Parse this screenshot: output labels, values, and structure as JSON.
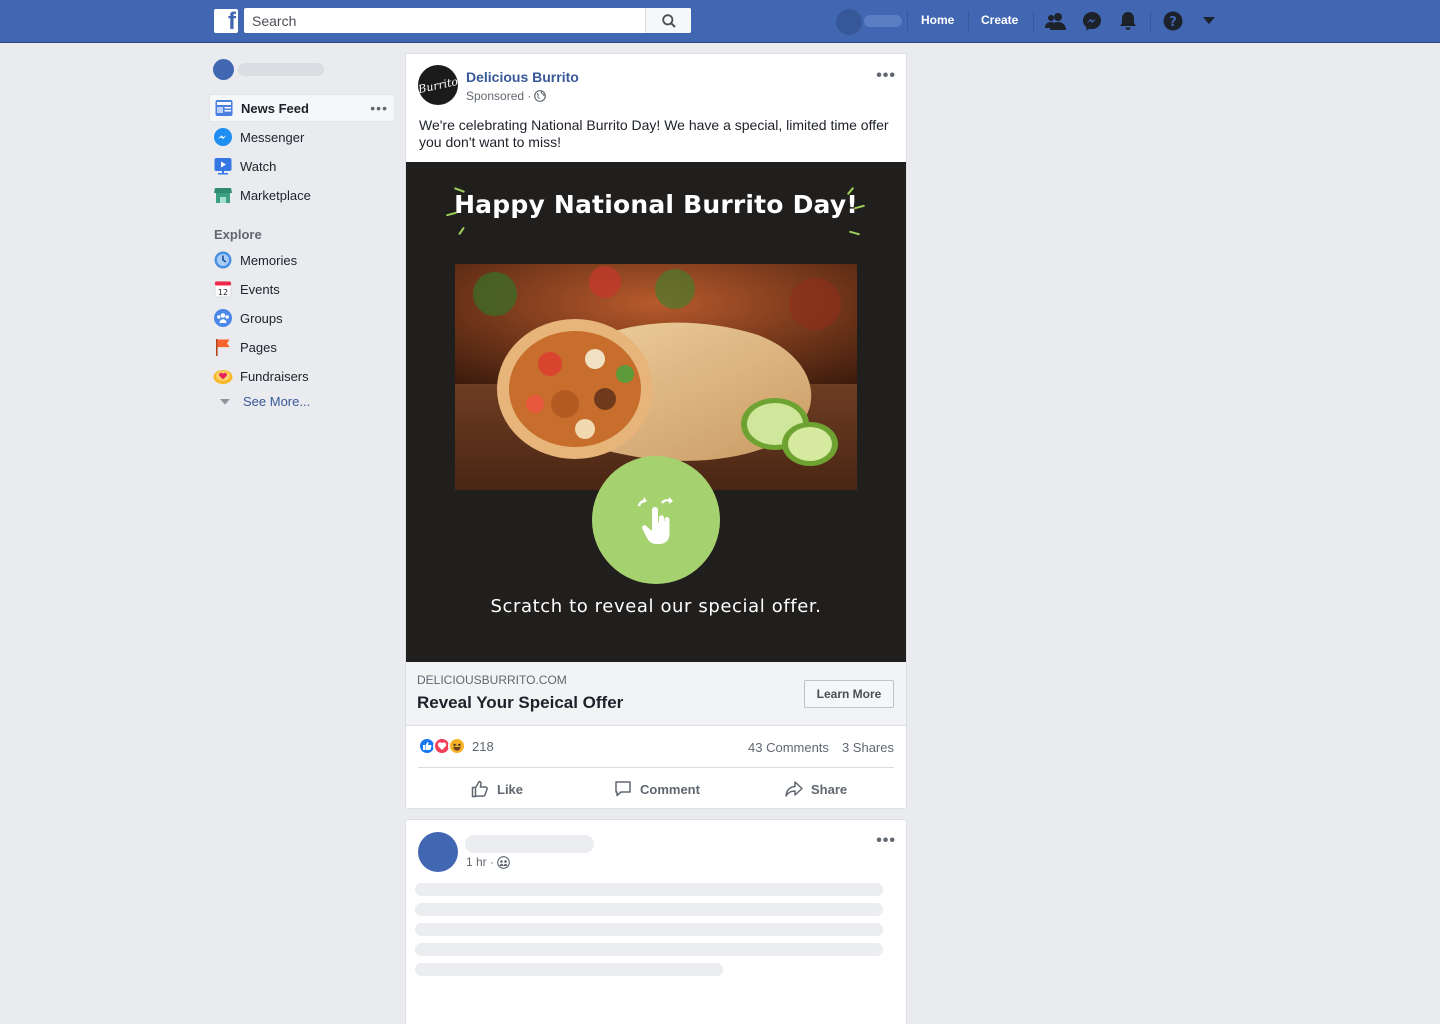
{
  "topbar": {
    "logo_letter": "f",
    "search_placeholder": "Search",
    "home_label": "Home",
    "create_label": "Create",
    "brand_color": "#4267b2"
  },
  "left_nav": {
    "items": [
      {
        "label": "News Feed",
        "icon": "news-feed-icon"
      },
      {
        "label": "Messenger",
        "icon": "messenger-icon"
      },
      {
        "label": "Watch",
        "icon": "watch-icon"
      },
      {
        "label": "Marketplace",
        "icon": "marketplace-icon"
      }
    ],
    "explore_heading": "Explore",
    "explore_items": [
      {
        "label": "Memories",
        "icon": "memories-icon"
      },
      {
        "label": "Events",
        "icon": "events-icon",
        "icon_text": "12"
      },
      {
        "label": "Groups",
        "icon": "groups-icon"
      },
      {
        "label": "Pages",
        "icon": "pages-flag-icon"
      },
      {
        "label": "Fundraisers",
        "icon": "fundraisers-icon"
      }
    ],
    "see_more": "See More..."
  },
  "post": {
    "page_name": "Delicious Burrito",
    "avatar_text": "Burrito",
    "sponsored": "Sponsored · ",
    "text": "We're celebrating National Burrito Day! We have a special, limited time offer you don't want to miss!",
    "creative": {
      "headline": "Happy National Burrito Day!",
      "scratch_text": "Scratch to reveal our special offer.",
      "background": "#211f1d",
      "accent": "#a5d16e"
    },
    "link": {
      "domain": "DELICIOUSBURRITO.COM",
      "title": "Reveal Your Speical Offer",
      "cta": "Learn More"
    },
    "reactions_count": "218",
    "comments": "43 Comments",
    "shares": "3 Shares",
    "actions": {
      "like": "Like",
      "comment": "Comment",
      "share": "Share"
    }
  },
  "post2": {
    "time": "1 hr · "
  }
}
